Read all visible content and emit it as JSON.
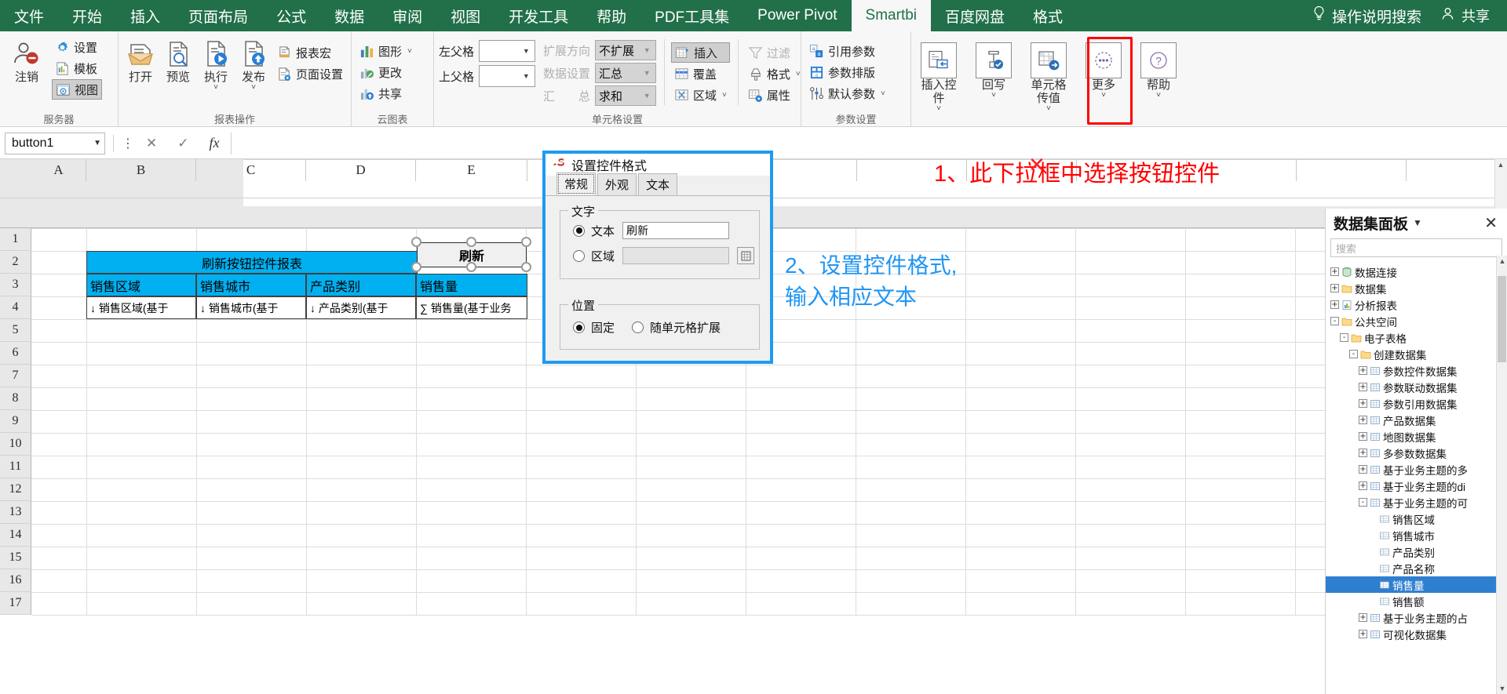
{
  "menu": {
    "items": [
      {
        "label": "文件",
        "active": false
      },
      {
        "label": "开始",
        "active": false
      },
      {
        "label": "插入",
        "active": false
      },
      {
        "label": "页面布局",
        "active": false
      },
      {
        "label": "公式",
        "active": false
      },
      {
        "label": "数据",
        "active": false
      },
      {
        "label": "审阅",
        "active": false
      },
      {
        "label": "视图",
        "active": false
      },
      {
        "label": "开发工具",
        "active": false
      },
      {
        "label": "帮助",
        "active": false
      },
      {
        "label": "PDF工具集",
        "active": false
      },
      {
        "label": "Power Pivot",
        "active": false
      },
      {
        "label": "Smartbi",
        "active": true
      },
      {
        "label": "百度网盘",
        "active": false
      },
      {
        "label": "格式",
        "active": false
      }
    ],
    "tell_me": "操作说明搜索",
    "share": "共享"
  },
  "ribbon": {
    "groups": [
      {
        "name": "服务器",
        "label": "服务器",
        "logout_label": "注销",
        "items": [
          {
            "label": "设置",
            "icon": "gear-icon",
            "selected": false
          },
          {
            "label": "模板",
            "icon": "template-icon",
            "selected": false
          },
          {
            "label": "视图",
            "icon": "view-icon",
            "selected": true
          }
        ]
      },
      {
        "name": "报表操作",
        "label": "报表操作",
        "big_buttons": [
          {
            "label": "打开",
            "icon": "open-file-icon",
            "caret": false
          },
          {
            "label": "预览",
            "icon": "preview-icon",
            "caret": false
          },
          {
            "label": "执行",
            "icon": "run-icon",
            "caret": true
          },
          {
            "label": "发布",
            "icon": "publish-icon",
            "caret": true
          }
        ],
        "items": [
          {
            "label": "报表宏",
            "icon": "macro-icon"
          },
          {
            "label": "页面设置",
            "icon": "page-setup-icon"
          }
        ]
      },
      {
        "name": "云图表",
        "label": "云图表",
        "items": [
          {
            "label": "图形",
            "icon": "chart-icon",
            "caret": true
          },
          {
            "label": "更改",
            "icon": "chart-edit-icon",
            "caret": false
          },
          {
            "label": "共享",
            "icon": "chart-share-icon",
            "caret": false
          }
        ]
      },
      {
        "name": "单元格设置",
        "label": "单元格设置",
        "fields": [
          {
            "label": "左父格",
            "value": "",
            "disabled": false
          },
          {
            "label": "上父格",
            "value": "",
            "disabled": false
          },
          {
            "label": "扩展方向",
            "value": "不扩展",
            "disabled": true
          },
          {
            "label": "数据设置",
            "value": "汇总",
            "disabled": true
          },
          {
            "label": "汇　　总",
            "value": "求和",
            "disabled": true
          }
        ],
        "items": [
          {
            "label": "插入",
            "icon": "insert-cell-icon",
            "selected": true,
            "caret": false
          },
          {
            "label": "覆盖",
            "icon": "overwrite-cell-icon",
            "selected": false,
            "caret": false
          },
          {
            "label": "区域",
            "icon": "area-cell-icon",
            "selected": false,
            "caret": true
          },
          {
            "label": "过滤",
            "icon": "filter-icon",
            "disabled": true,
            "caret": false
          },
          {
            "label": "格式",
            "icon": "format-brush-icon",
            "caret": true
          },
          {
            "label": "属性",
            "icon": "properties-icon",
            "caret": false
          }
        ]
      },
      {
        "name": "参数设置",
        "label": "参数设置",
        "items": [
          {
            "label": "引用参数",
            "icon": "reference-param-icon",
            "caret": false
          },
          {
            "label": "参数排版",
            "icon": "param-layout-icon",
            "caret": false
          },
          {
            "label": "默认参数",
            "icon": "default-param-icon",
            "caret": true
          }
        ]
      },
      {
        "name": "控件组",
        "label": "",
        "big_buttons": [
          {
            "label": "插入控件",
            "icon": "insert-control-icon",
            "caret": true,
            "highlighted": true
          },
          {
            "label": "回写",
            "icon": "writeback-icon",
            "caret": true,
            "highlighted": false
          },
          {
            "label": "单元格传值",
            "icon": "cell-pass-value-icon",
            "caret": true,
            "highlighted": false
          },
          {
            "label": "更多",
            "icon": "more-icon",
            "caret": true,
            "highlighted": false
          },
          {
            "label": "帮助",
            "icon": "help-icon",
            "caret": true,
            "highlighted": false
          }
        ]
      }
    ]
  },
  "formula_bar": {
    "name_box": "button1",
    "cancel_icon": "cancel-icon",
    "confirm_icon": "confirm-icon",
    "fx_icon": "fx-icon",
    "formula": ""
  },
  "sheet": {
    "columns": [
      "A",
      "B",
      "C",
      "D",
      "E"
    ],
    "rows": [
      "1",
      "2",
      "3",
      "4",
      "5",
      "6",
      "7",
      "8",
      "9",
      "10",
      "11",
      "12",
      "13",
      "14",
      "15",
      "16",
      "17"
    ],
    "title_cell": "刷新按钮控件报表",
    "header_cells": [
      "销售区域",
      "销售城市",
      "产品类别",
      "销售量"
    ],
    "data_cells": [
      "↓ 销售区域(基于",
      "↓ 销售城市(基于",
      "↓ 产品类别(基于",
      "∑ 销售量(基于业务"
    ],
    "button_shape_label": "刷新"
  },
  "dialog": {
    "title": "设置控件格式",
    "logo_icon": "smartbi-logo-icon",
    "tabs": [
      {
        "label": "常规",
        "active": true
      },
      {
        "label": "外观",
        "active": false
      },
      {
        "label": "文本",
        "active": false
      }
    ],
    "text_group": {
      "legend": "文字",
      "options": [
        {
          "label": "文本",
          "selected": true,
          "value": "刷新",
          "disabled": false
        },
        {
          "label": "区域",
          "selected": false,
          "value": "",
          "disabled": true
        }
      ],
      "pick_icon": "cell-picker-icon"
    },
    "position_group": {
      "legend": "位置",
      "options": [
        {
          "label": "固定",
          "selected": true
        },
        {
          "label": "随单元格扩展",
          "selected": false
        }
      ]
    }
  },
  "annotations": [
    {
      "id": "note-1",
      "text": "1、此下拉框中选择按钮控件",
      "color": "#ff0000"
    },
    {
      "id": "note-2-line1",
      "text": "2、设置控件格式,",
      "color": "#2196f3"
    },
    {
      "id": "note-2-line2",
      "text": "输入相应文本",
      "color": "#2196f3"
    }
  ],
  "right_panel": {
    "title": "数据集面板",
    "caret_icon": "chevron-down-icon",
    "close_icon": "close-icon",
    "search_placeholder": "搜索",
    "tree": [
      {
        "label": "数据连接",
        "indent": 0,
        "expander": "+",
        "icon": "db-connect-icon",
        "selected": false
      },
      {
        "label": "数据集",
        "indent": 0,
        "expander": "+",
        "icon": "folder-icon",
        "selected": false
      },
      {
        "label": "分析报表",
        "indent": 0,
        "expander": "+",
        "icon": "report-icon",
        "selected": false
      },
      {
        "label": "公共空间",
        "indent": 0,
        "expander": "-",
        "icon": "folder-icon",
        "selected": false
      },
      {
        "label": "电子表格",
        "indent": 1,
        "expander": "-",
        "icon": "folder-icon",
        "selected": false
      },
      {
        "label": "创建数据集",
        "indent": 2,
        "expander": "-",
        "icon": "folder-icon",
        "selected": false
      },
      {
        "label": "参数控件数据集",
        "indent": 3,
        "expander": "+",
        "icon": "dataset-icon",
        "selected": false
      },
      {
        "label": "参数联动数据集",
        "indent": 3,
        "expander": "+",
        "icon": "dataset-icon",
        "selected": false
      },
      {
        "label": "参数引用数据集",
        "indent": 3,
        "expander": "+",
        "icon": "dataset-icon",
        "selected": false
      },
      {
        "label": "产品数据集",
        "indent": 3,
        "expander": "+",
        "icon": "dataset-icon",
        "selected": false
      },
      {
        "label": "地图数据集",
        "indent": 3,
        "expander": "+",
        "icon": "dataset-icon",
        "selected": false
      },
      {
        "label": "多参数数据集",
        "indent": 3,
        "expander": "+",
        "icon": "dataset-icon",
        "selected": false
      },
      {
        "label": "基于业务主题的多",
        "indent": 3,
        "expander": "+",
        "icon": "dataset-icon",
        "selected": false
      },
      {
        "label": "基于业务主题的di",
        "indent": 3,
        "expander": "+",
        "icon": "dataset-icon",
        "selected": false
      },
      {
        "label": "基于业务主题的可",
        "indent": 3,
        "expander": "-",
        "icon": "dataset-icon",
        "selected": false
      },
      {
        "label": "销售区域",
        "indent": 4,
        "expander": "",
        "icon": "field-icon",
        "selected": false
      },
      {
        "label": "销售城市",
        "indent": 4,
        "expander": "",
        "icon": "field-icon",
        "selected": false
      },
      {
        "label": "产品类别",
        "indent": 4,
        "expander": "",
        "icon": "field-icon",
        "selected": false
      },
      {
        "label": "产品名称",
        "indent": 4,
        "expander": "",
        "icon": "field-icon",
        "selected": false
      },
      {
        "label": "销售量",
        "indent": 4,
        "expander": "",
        "icon": "field-icon",
        "selected": true
      },
      {
        "label": "销售额",
        "indent": 4,
        "expander": "",
        "icon": "field-icon",
        "selected": false
      },
      {
        "label": "基于业务主题的占",
        "indent": 3,
        "expander": "+",
        "icon": "dataset-icon",
        "selected": false
      },
      {
        "label": "可视化数据集",
        "indent": 3,
        "expander": "+",
        "icon": "dataset-icon",
        "selected": false
      }
    ]
  },
  "colors": {
    "ribbon_green": "#21704a",
    "accent_cyan": "#00b0f0",
    "annotation_red": "#ff0000",
    "annotation_blue": "#2196f3",
    "dialog_border": "#1e9bef",
    "tree_selection": "#2f7fd1"
  }
}
